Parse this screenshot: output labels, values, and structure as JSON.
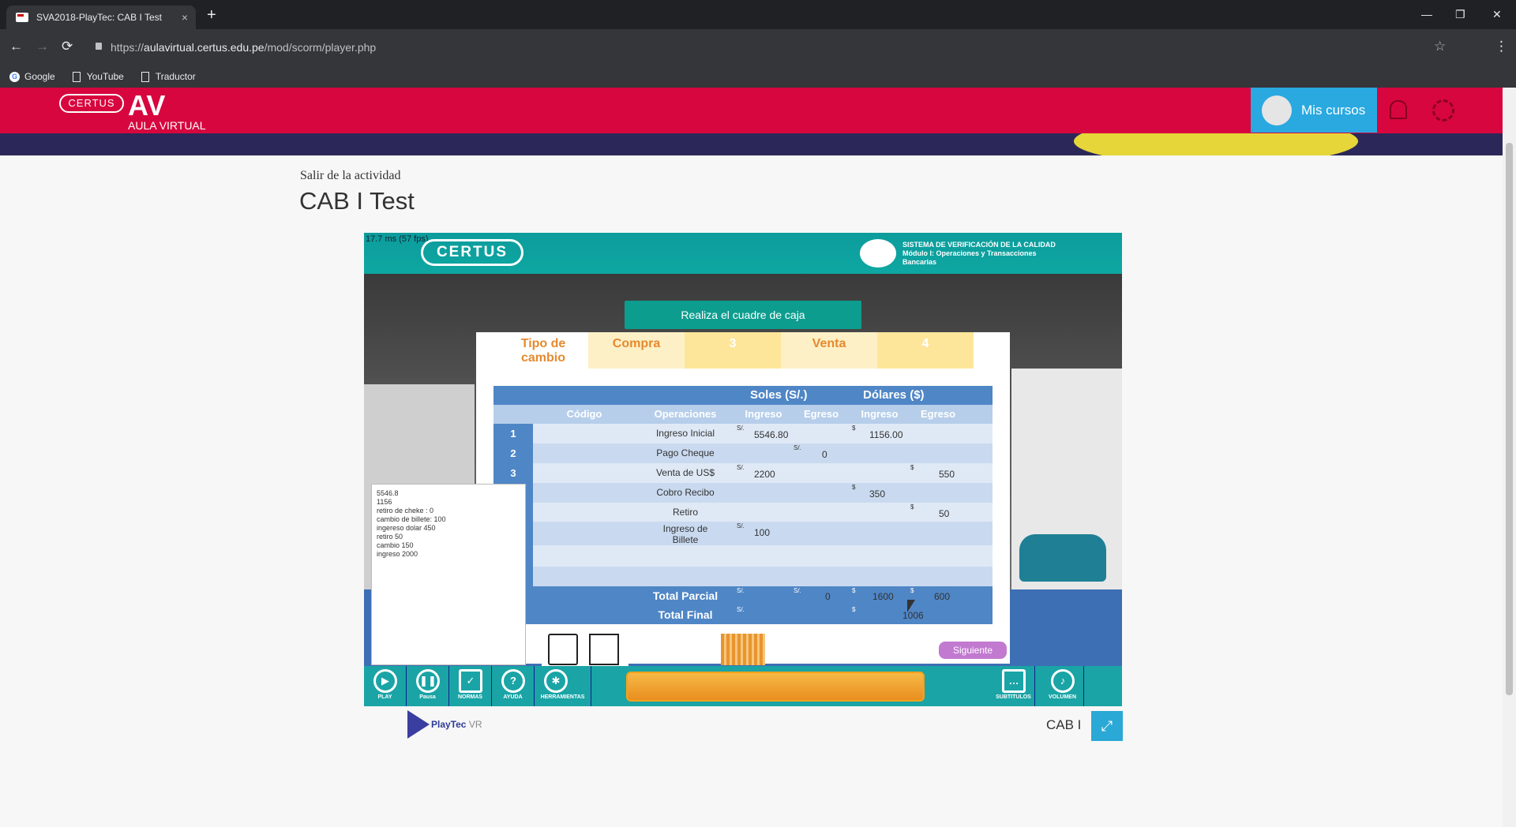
{
  "browser": {
    "tab_title": "SVA2018-PlayTec: CAB I Test",
    "tab_close": "×",
    "new_tab": "+",
    "win_min": "—",
    "win_max": "❐",
    "win_close": "✕",
    "back": "←",
    "forward": "→",
    "reload": "⟳",
    "url_prefix": "https://",
    "url_host": "aulavirtual.certus.edu.pe",
    "url_path": "/mod/scorm/player.php",
    "star": "☆",
    "menu": "⋮",
    "bookmarks": [
      {
        "label": "Google"
      },
      {
        "label": "YouTube"
      },
      {
        "label": "Traductor"
      }
    ]
  },
  "site": {
    "logo_pill": "CERTUS",
    "logo_av": "AV",
    "logo_sub": "AULA VIRTUAL",
    "mis_cursos": "Mis cursos"
  },
  "page": {
    "exit_link": "Salir de la actividad",
    "title": "CAB I Test"
  },
  "player": {
    "fps": "17.7 ms (57 fps)",
    "brand": "CERTUS",
    "svc_line1": "SISTEMA DE VERIFICACIÓN DE LA CALIDAD",
    "svc_line2": "Módulo I: Operaciones y Transacciones",
    "svc_line3": "Bancarias",
    "instruction": "Realiza el cuadre de caja",
    "tipo_cambio": "Tipo de cambio",
    "compra_label": "Compra",
    "compra_value": "3",
    "venta_label": "Venta",
    "venta_value": "4",
    "soles_header": "Soles (S/.)",
    "dolares_header": "Dólares ($)",
    "col_codigo": "Código",
    "col_operaciones": "Operaciones",
    "col_ingreso_s": "Ingreso",
    "col_egreso_s": "Egreso",
    "col_ingreso_d": "Ingreso",
    "col_egreso_d": "Egreso",
    "sol_symbol": "S/.",
    "usd_symbol": "$",
    "rows": [
      {
        "num": "1",
        "op": "Ingreso Inicial",
        "si": "5546.80",
        "se": "",
        "di": "1156.00",
        "de": ""
      },
      {
        "num": "2",
        "op": "Pago Cheque",
        "si": "",
        "se": "0",
        "di": "",
        "de": ""
      },
      {
        "num": "3",
        "op": "Venta de US$",
        "si": "2200",
        "se": "",
        "di": "",
        "de": "550"
      },
      {
        "num": "",
        "op": "Cobro Recibo",
        "si": "",
        "se": "",
        "di": "350",
        "de": ""
      },
      {
        "num": "",
        "op": "Retiro",
        "si": "",
        "se": "",
        "di": "",
        "de": "50"
      },
      {
        "num": "",
        "op": "Ingreso de Billete",
        "si": "100",
        "se": "",
        "di": "",
        "de": ""
      }
    ],
    "total_parcial_label": "Total Parcial",
    "total_parcial_se": "0",
    "total_parcial_di": "1600",
    "total_parcial_de": "600",
    "total_final_label": "Total Final",
    "total_final_d": "1006",
    "notes": [
      "5546.8",
      "1156",
      "retiro de cheke : 0",
      "cambio de billete: 100",
      "ingereso dolar 450",
      "retiro 50",
      "cambio 150",
      "ingreso 2000"
    ],
    "siguiente": "Siguiente",
    "controls": [
      {
        "label": "PLAY",
        "icon": "▶"
      },
      {
        "label": "Pausa",
        "icon": "❚❚"
      },
      {
        "label": "NORMAS",
        "icon": "✓"
      },
      {
        "label": "AYUDA",
        "icon": "?"
      },
      {
        "label": "HERRAMIENTAS",
        "icon": "✱"
      }
    ],
    "subtitulos": "SUBTITULOS",
    "volumen": "VOLUMEN",
    "subtitulos_icon": "…",
    "volumen_icon": "♪"
  },
  "footer": {
    "playtec": "PlayTec",
    "playtec_vr": "VR",
    "cab_label": "CAB I",
    "fullscreen_icon": "⤢"
  }
}
